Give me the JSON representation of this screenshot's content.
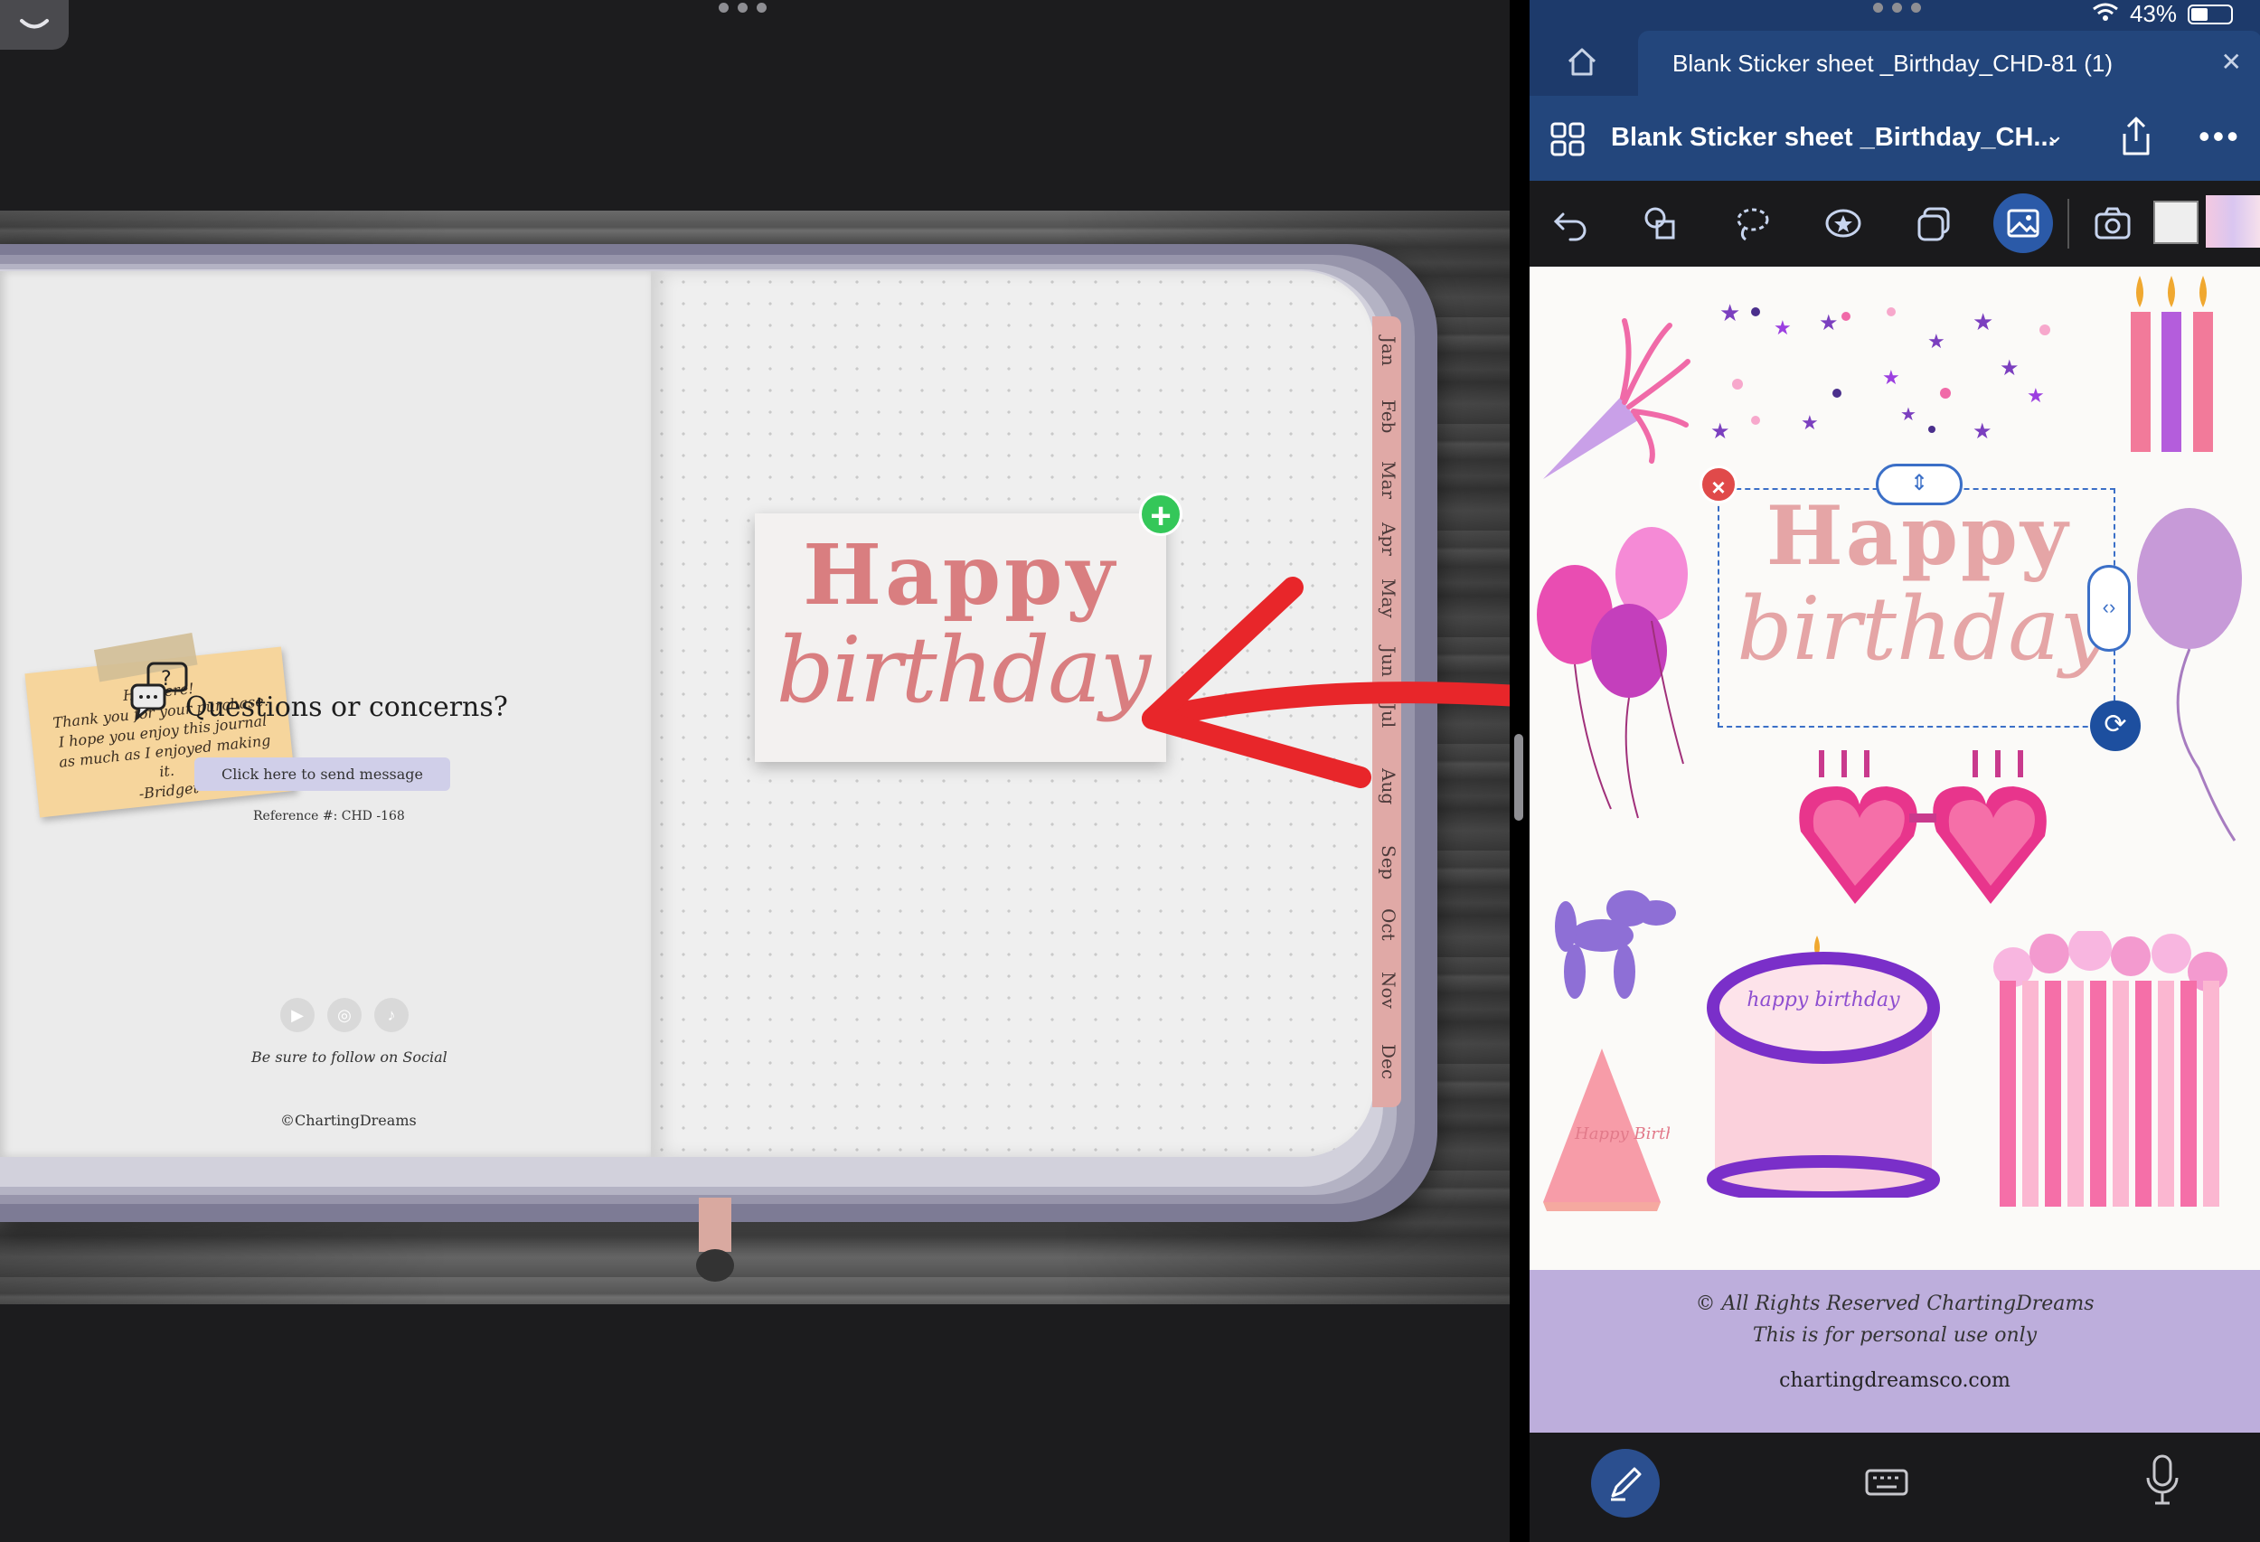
{
  "left": {
    "sticky_note_text": "Hi, there!\nThank you for your purchase.\nI hope you enjoy this journal\nas much as I enjoyed making it.\n-Bridget",
    "questions_heading": "Questions or concerns?",
    "send_message_label": "Click here to send message",
    "reference": "Reference #: CHD -168",
    "follow_text": "Be sure to follow on Social",
    "copyright": "©ChartingDreams",
    "sticker_line1": "Happy",
    "sticker_line2": "birthday",
    "month_tabs": [
      "Jan",
      "Feb",
      "Mar",
      "Apr",
      "May",
      "Jun",
      "Jul",
      "Aug",
      "Sep",
      "Oct",
      "Nov",
      "Dec"
    ],
    "social_icons": [
      "youtube-icon",
      "instagram-icon",
      "tiktok-icon"
    ],
    "colors": {
      "arrow": "#e8262a",
      "add_button": "#34c759",
      "sticker_text": "#d97e80",
      "tabs": "#e0a9a6"
    }
  },
  "right": {
    "status": {
      "battery": "43%"
    },
    "tab_title": "Blank Sticker sheet _Birthday_CHD-81 (1)",
    "doc_title": "Blank Sticker sheet _Birthday_CH...",
    "selected_line1": "Happy",
    "selected_line2": "birthday",
    "cake_text": "happy birthday",
    "hat_text": "Happy Birthday",
    "footer": {
      "rights": "© All Rights Reserved ChartingDreams",
      "personal": "This is for personal use only",
      "url": "chartingdreamsco.com"
    },
    "colors": {
      "topbar": "#1d3a6b",
      "footer_band": "#bdaedc",
      "selection": "#3b6fc7"
    }
  }
}
